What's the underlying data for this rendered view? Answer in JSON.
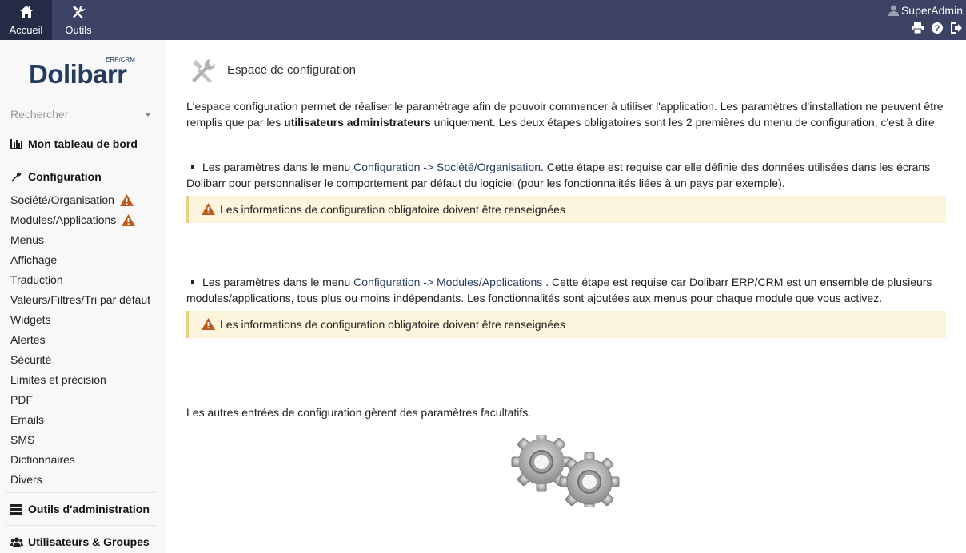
{
  "topbar": {
    "menus": [
      {
        "label": "Accueil",
        "icon": "home-icon",
        "active": true
      },
      {
        "label": "Outils",
        "icon": "tools-icon",
        "active": false
      }
    ],
    "user": "SuperAdmin",
    "icons": [
      "print-icon",
      "help-icon",
      "logout-icon"
    ],
    "color": "#3b4263"
  },
  "sidebar": {
    "logo_text": "Dolibarr",
    "logo_sup": "ERP/CRM",
    "search_placeholder": "Rechercher",
    "dashboard": "Mon tableau de bord",
    "config_title": "Configuration",
    "items": [
      {
        "label": "Société/Organisation",
        "warning": true
      },
      {
        "label": "Modules/Applications",
        "warning": true
      },
      {
        "label": "Menus"
      },
      {
        "label": "Affichage"
      },
      {
        "label": "Traduction"
      },
      {
        "label": "Valeurs/Filtres/Tri par défaut"
      },
      {
        "label": "Widgets"
      },
      {
        "label": "Alertes"
      },
      {
        "label": "Sécurité"
      },
      {
        "label": "Limites et précision"
      },
      {
        "label": "PDF"
      },
      {
        "label": "Emails"
      },
      {
        "label": "SMS"
      },
      {
        "label": "Dictionnaires"
      },
      {
        "label": "Divers"
      }
    ],
    "admin_tools": "Outils d'administration",
    "users_groups": "Utilisateurs & Groupes"
  },
  "main": {
    "title": "Espace de configuration",
    "intro_part1": "L'espace configuration permet de réaliser le paramétrage afin de pouvoir commencer à utiliser l'application. Les paramètres d'installation ne peuvent être remplis que par les ",
    "intro_bold": "utilisateurs administrateurs",
    "intro_part2": " uniquement. Les deux étapes obligatoires sont les 2 premières du menu de configuration, c'est à dire",
    "step1": {
      "prefix": "Les paramètres dans le menu ",
      "link1": "Configuration",
      "arrow": " -> ",
      "link2": "Société/Organisation",
      "suffix": ". Cette étape est requise car elle définie des données utilisées dans les écrans Dolibarr pour personnaliser le comportement par défaut du logiciel (pour les fonctionnalités liées à un pays par exemple)."
    },
    "warning1": "Les informations de configuration obligatoire doivent être renseignées",
    "step2": {
      "prefix": "Les paramètres dans le menu ",
      "link1": "Configuration",
      "arrow": " -> ",
      "link2": "Modules/Applications",
      "suffix": " . Cette étape est requise car Dolibarr ERP/CRM est un ensemble de plusieurs modules/applications, tous plus ou moins indépendants. Les fonctionnalités sont ajoutées aux menus pour chaque module que vous activez."
    },
    "warning2": "Les informations de configuration obligatoire doivent être renseignées",
    "optional": "Les autres entrées de configuration gèrent des paramètres facultatifs."
  },
  "colors": {
    "warning_bg": "#fcf4dc",
    "warning_icon": "#bc5a1d",
    "link": "#263c5c"
  }
}
